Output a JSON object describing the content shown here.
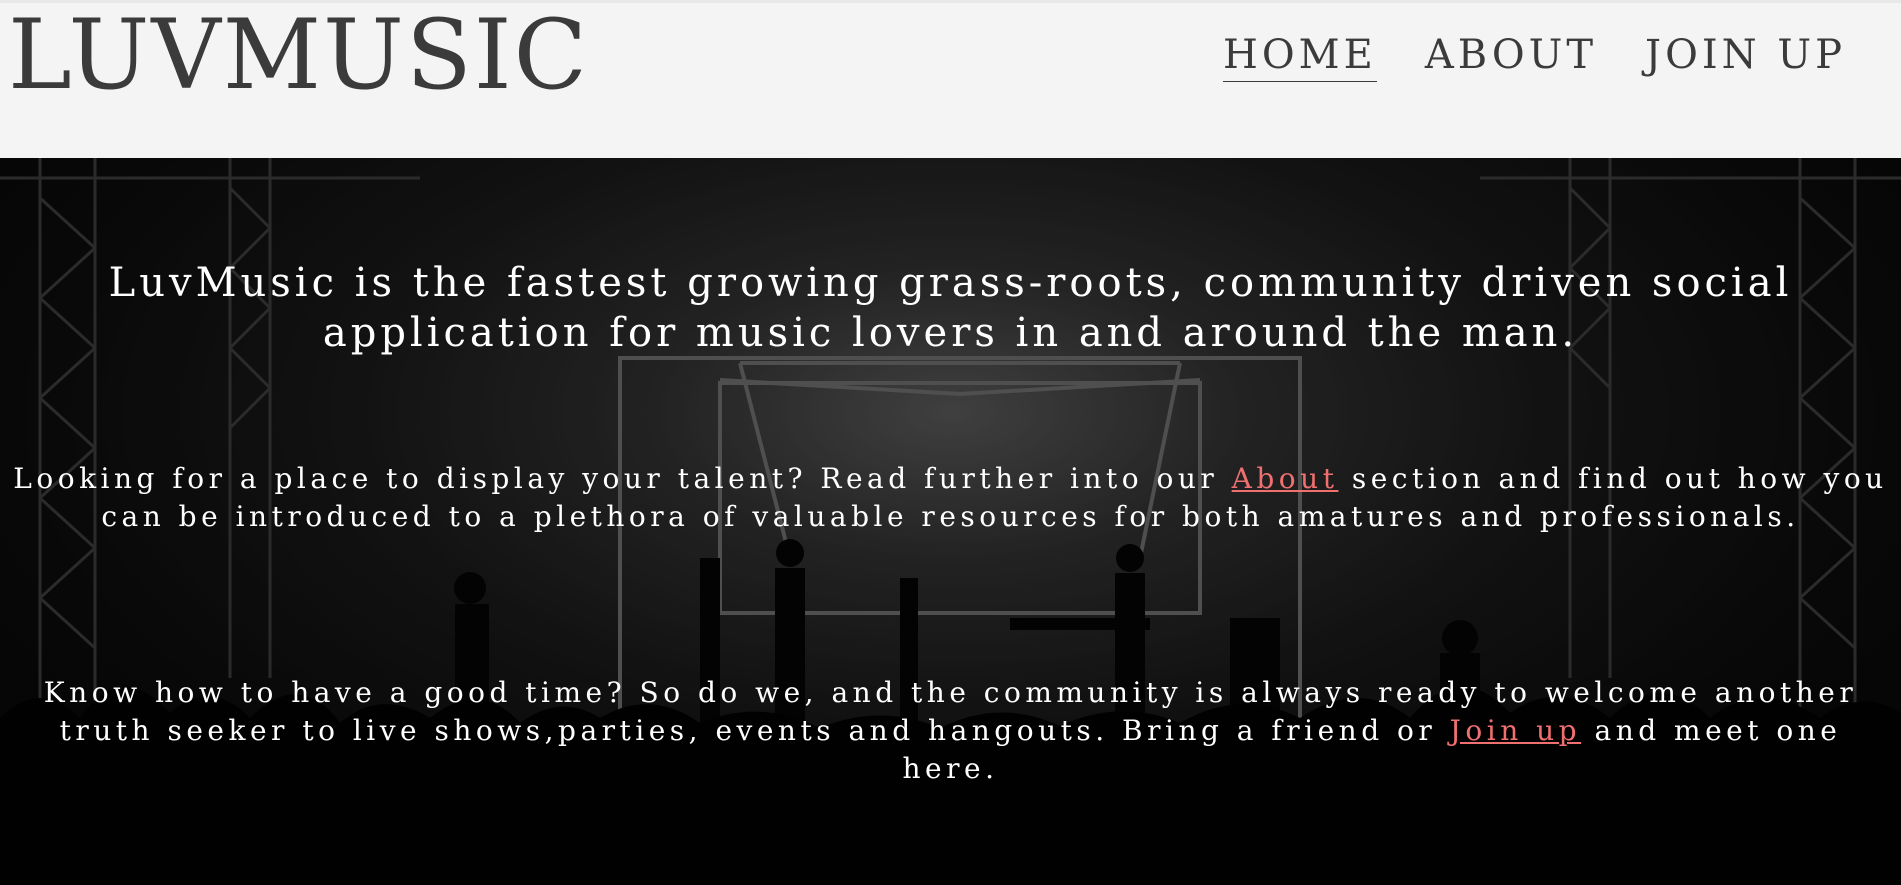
{
  "header": {
    "logo": "LUVMUSIC",
    "nav": [
      {
        "label": "HOME",
        "active": true
      },
      {
        "label": "ABOUT",
        "active": false
      },
      {
        "label": "JOIN UP",
        "active": false
      }
    ]
  },
  "hero": {
    "lead": "LuvMusic is the fastest growing grass-roots, community driven social application for music lovers in and around the man.",
    "para1": {
      "before": "Looking for a place to display your talent? Read further into our ",
      "link": "About",
      "after": " section and find out how you can be introduced to a plethora of valuable resources for both amatures and professionals."
    },
    "para2": {
      "before": "Know how to have a good time? So do we, and the community is always ready to welcome another truth seeker to live shows,parties, events and hangouts. Bring a friend or ",
      "link": "Join up",
      "after": " and meet one here."
    }
  },
  "colors": {
    "header_bg": "#f4f4f4",
    "logo_text": "#3b3b3b",
    "hero_text": "#ffffff",
    "link": "#f07070"
  },
  "icons": {
    "hero_background": "concert-stage-silhouette-image"
  }
}
